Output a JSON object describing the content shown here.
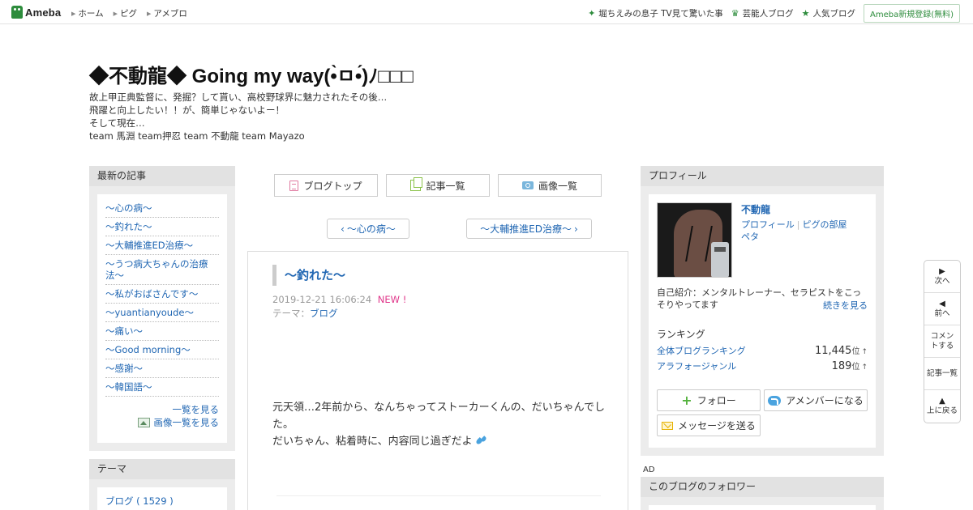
{
  "topbar": {
    "logo": "Ameba",
    "nav": [
      "ホーム",
      "ピグ",
      "アメブロ"
    ],
    "right_links": [
      "堀ちえみの息子 TV見て驚いた事",
      "芸能人ブログ",
      "人気ブログ"
    ],
    "register": "Ameba新規登録(無料)"
  },
  "header": {
    "title": "◆不動龍◆ Going my way(•̀ㅁ•́)ﾉ□□□",
    "desc": [
      "故上甲正典監督に、発掘？して貰い、高校野球界に魅力されたその後…",
      "飛躍と向上したい！！が、簡単じゃないよー！",
      "そして現在…",
      "team 馬淵 team押忍 team 不動龍 team Mayazo"
    ]
  },
  "left": {
    "recent_heading": "最新の記事",
    "recent": [
      "〜心の病〜",
      "〜釣れた〜",
      "〜大輔推進ED治療〜",
      "〜うつ病大ちゃんの治療法〜",
      "〜私がおばさんです〜",
      "〜yuantianyoude〜",
      "〜痛い〜",
      "〜Good morning〜",
      "〜感謝〜",
      "〜韓国語〜"
    ],
    "see_list": "一覧を見る",
    "see_images": "画像一覧を見る",
    "theme_heading": "テーマ",
    "theme_item": "ブログ ( 1529 )"
  },
  "center": {
    "buttons": [
      "ブログトップ",
      "記事一覧",
      "画像一覧"
    ],
    "prev": "〜心の病〜",
    "next": "〜大輔推進ED治療〜",
    "entry": {
      "title": "〜釣れた〜",
      "date": "2019-12-21 16:06:24",
      "new": "NEW !",
      "theme_label": "テーマ：",
      "theme": "ブログ",
      "body1": "元天領…2年前から、なんちゃってストーカーくんの、だいちゃんでした。",
      "body2": "だいちゃん、粘着時に、内容同じ過ぎだよ"
    }
  },
  "right": {
    "profile_heading": "プロフィール",
    "name": "不動龍",
    "links": [
      "プロフィール",
      "ピグの部屋",
      "ペタ"
    ],
    "intro": "自己紹介：メンタルトレーナー、セラピストをこっそりやってます",
    "intro_more": "続きを見る",
    "ranking_label": "ランキング",
    "rankings": [
      {
        "label": "全体ブログランキング",
        "value": "11,445",
        "unit": "位"
      },
      {
        "label": "アラフォージャンル",
        "value": "189",
        "unit": "位"
      }
    ],
    "follow": "フォロー",
    "amember": "アメンバーになる",
    "message": "メッセージを送る",
    "ad": "AD",
    "followers_heading": "このブログのフォロワー"
  },
  "float": {
    "next": "次へ",
    "prev": "前へ",
    "comment": "コメントする",
    "list": "記事一覧",
    "top": "上に戻る"
  }
}
